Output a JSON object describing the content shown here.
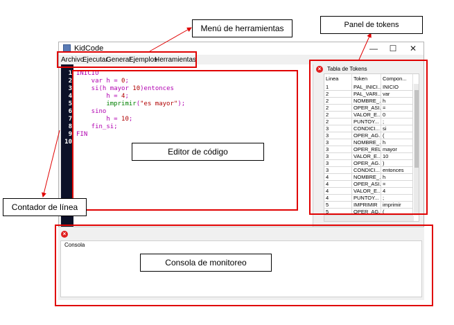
{
  "window": {
    "title": "KidCode",
    "minimize": "—",
    "maximize": "☐",
    "close": "✕"
  },
  "menu": [
    "Archivo",
    "Ejecutar",
    "Generar",
    "Ejemplos",
    "Herramientas"
  ],
  "editor": {
    "line_numbers": [
      "1",
      "2",
      "3",
      "4",
      "5",
      "6",
      "7",
      "8",
      "9",
      "10"
    ],
    "lines": [
      [
        {
          "t": "INICIO",
          "c": "kw"
        }
      ],
      [
        {
          "t": "    var ",
          "c": "kw"
        },
        {
          "t": "h",
          "c": "kw"
        },
        {
          "t": " = ",
          "c": "kw"
        },
        {
          "t": "0",
          "c": "nm"
        },
        {
          "t": ";",
          "c": "kw"
        }
      ],
      [
        {
          "t": "    si",
          "c": "kw"
        },
        {
          "t": "(h ",
          "c": "kw"
        },
        {
          "t": "mayor",
          "c": "kw"
        },
        {
          "t": " 10",
          "c": "nm"
        },
        {
          "t": ")entonces",
          "c": "kw"
        }
      ],
      [
        {
          "t": "        h = ",
          "c": "kw"
        },
        {
          "t": "4",
          "c": "nm"
        },
        {
          "t": ";",
          "c": "kw"
        }
      ],
      [
        {
          "t": "        imprimir",
          "c": "fn"
        },
        {
          "t": "(",
          "c": "kw"
        },
        {
          "t": "\"es mayor\"",
          "c": "st"
        },
        {
          "t": ");",
          "c": "kw"
        }
      ],
      [
        {
          "t": "    sino",
          "c": "kw"
        }
      ],
      [
        {
          "t": "        h = ",
          "c": "kw"
        },
        {
          "t": "10",
          "c": "nm"
        },
        {
          "t": ";",
          "c": "kw"
        }
      ],
      [
        {
          "t": "    fin_si;",
          "c": "kw"
        }
      ],
      [
        {
          "t": "FIN",
          "c": "kw"
        }
      ],
      []
    ]
  },
  "token_panel": {
    "title": "Tabla de Tokens",
    "columns": [
      "Linea",
      "Token",
      "Compon..."
    ],
    "rows": [
      [
        "1",
        "PAL_INICI...",
        "INICIO"
      ],
      [
        "2",
        "PAL_VARI...",
        "var"
      ],
      [
        "2",
        "NOMBRE_...",
        "h"
      ],
      [
        "2",
        "OPER_ASI...",
        "="
      ],
      [
        "2",
        "VALOR_E...",
        "0"
      ],
      [
        "2",
        "PUNTOY...",
        ";"
      ],
      [
        "3",
        "CONDICI...",
        "si"
      ],
      [
        "3",
        "OPER_AG...",
        "("
      ],
      [
        "3",
        "NOMBRE_...",
        "h"
      ],
      [
        "3",
        "OPER_REL",
        "mayor"
      ],
      [
        "3",
        "VALOR_E...",
        "10"
      ],
      [
        "3",
        "OPER_AG...",
        ")"
      ],
      [
        "3",
        "CONDICI...",
        "entonces"
      ],
      [
        "4",
        "NOMBRE_...",
        "h"
      ],
      [
        "4",
        "OPER_ASI...",
        "="
      ],
      [
        "4",
        "VALOR_E...",
        "4"
      ],
      [
        "4",
        "PUNTOY...",
        ";"
      ],
      [
        "5",
        "IMPRIMIR",
        "imprimir"
      ],
      [
        "5",
        "OPER_AG...",
        "("
      ]
    ]
  },
  "console": {
    "label": "Consola"
  },
  "annotations": {
    "menu_tools": "Menú de herramientas",
    "token_panel": "Panel de tokens",
    "code_editor": "Editor de código",
    "line_counter": "Contador de línea",
    "monitor_console": "Consola de monitoreo"
  },
  "colors": {
    "annotation": "#e00000",
    "gutter": "#0c1128",
    "keyword": "#b000b0",
    "function": "#008000",
    "string": "#b00000"
  }
}
